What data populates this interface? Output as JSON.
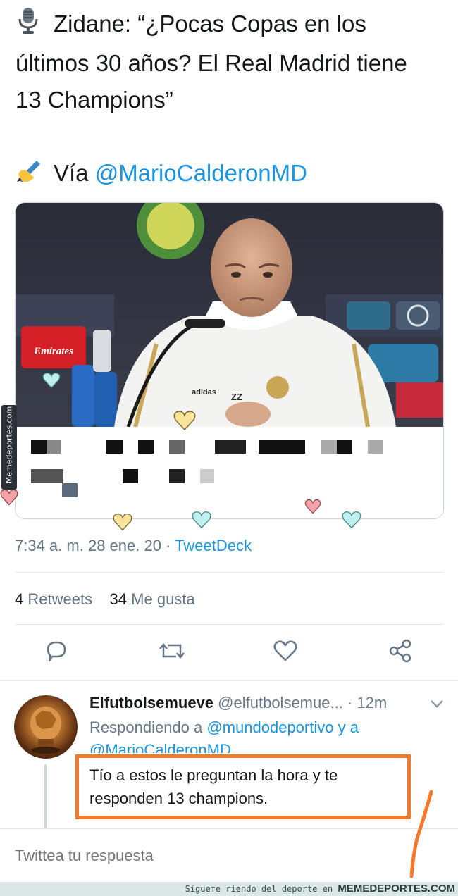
{
  "tweet": {
    "line1": "Zidane: “¿Pocas Copas en los",
    "line2": "últimos 30 años? El Real Madrid tiene",
    "line3": "13 Champions”",
    "via_prefix": "Vía",
    "via_handle": "@MarioCalderonMD",
    "mic_icon": "microphone-icon",
    "writing_icon": "writing-hand-icon"
  },
  "media": {
    "emirates_label": "Emirates",
    "kit_label": "adidas",
    "initials": "ZZ"
  },
  "meta": {
    "time": "7:34 a. m.",
    "date": "28 ene. 20",
    "separator": "·",
    "source": "TweetDeck"
  },
  "stats": {
    "retweets_count": "4",
    "retweets_label": "Retweets",
    "likes_count": "34",
    "likes_label": "Me gusta"
  },
  "reply": {
    "name": "Elfutbolsemueve",
    "handle": "@elfutbolsemue...",
    "time": "· 12m",
    "replying_prefix": "Respondiendo a",
    "replying_to_1": "@mundodeportivo",
    "replying_and": "y a",
    "replying_to_2": "@MarioCalderonMD",
    "text_line1": "Tío a estos le preguntan la hora y te",
    "text_line2": "responden 13 champions."
  },
  "compose": {
    "placeholder": "Twittea tu respuesta"
  },
  "watermark": {
    "side": "Memedeportes.com",
    "footer_prefix": "Sigue",
    "footer_text": "Sígueте riendo del deporte en",
    "footer_site": "MEMEDEPORTES.COM"
  },
  "colors": {
    "link": "#1b95e0",
    "muted": "#657786",
    "highlight": "#f5792a"
  }
}
